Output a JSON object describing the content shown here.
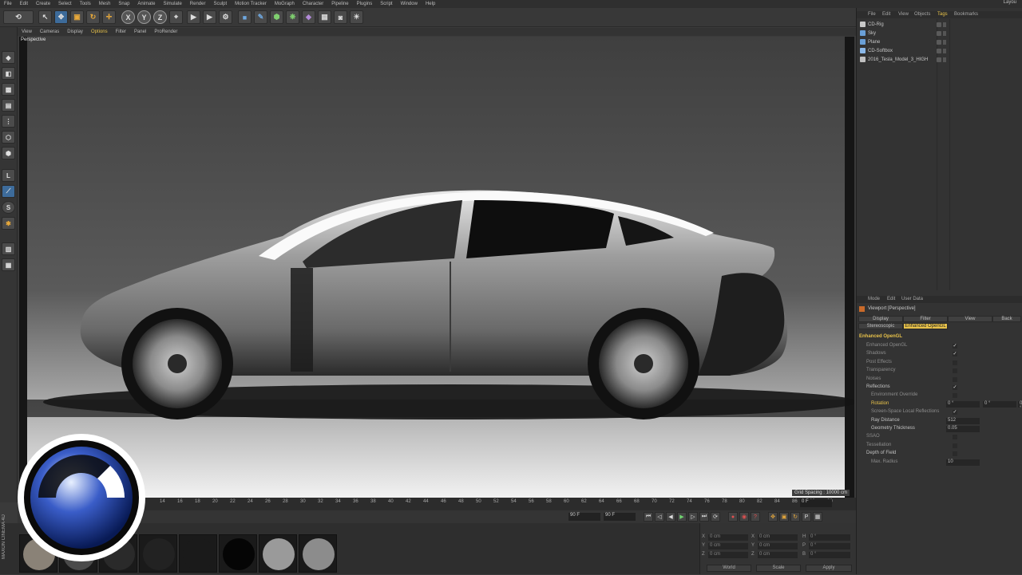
{
  "menubar": {
    "items": [
      "File",
      "Edit",
      "Create",
      "Select",
      "Tools",
      "Mesh",
      "Snap",
      "Animate",
      "Simulate",
      "Render",
      "Sculpt",
      "Motion Tracker",
      "MoGraph",
      "Character",
      "Pipeline",
      "Plugins",
      "Script",
      "Window",
      "Help"
    ],
    "layout_label": "Layou"
  },
  "toolbar": {
    "axis_x": "X",
    "axis_y": "Y",
    "axis_z": "Z"
  },
  "viewport_menu": {
    "items": [
      "View",
      "Cameras",
      "Display",
      "Options",
      "Filter",
      "Panel",
      "ProRender"
    ],
    "active": "Options"
  },
  "viewport": {
    "label": "Perspective",
    "grid_spacing": "Grid Spacing : 10000 cm"
  },
  "timeline": {
    "ticks": [
      "14",
      "16",
      "18",
      "20",
      "22",
      "24",
      "26",
      "28",
      "30",
      "32",
      "34",
      "36",
      "38",
      "40",
      "42",
      "44",
      "46",
      "48",
      "50",
      "52",
      "54",
      "56",
      "58",
      "60",
      "62",
      "64",
      "66",
      "68",
      "70",
      "72",
      "74",
      "76",
      "78",
      "80",
      "82",
      "84",
      "86",
      "88",
      "90"
    ],
    "current_frame": "0 F",
    "end_frame": "90 F",
    "start_field": "90 F"
  },
  "left_tools": {
    "s_label": "S"
  },
  "object_manager": {
    "menu": [
      "File",
      "Edit",
      "View",
      "Objects",
      "Tags",
      "Bookmarks"
    ],
    "active_menu": "Tags",
    "objects": [
      {
        "name": "CD-Rig",
        "icon_color": "#c8c8c8"
      },
      {
        "name": "Sky",
        "icon_color": "#6aa0d8"
      },
      {
        "name": "Plane",
        "icon_color": "#6aa0d8"
      },
      {
        "name": "CD-Softbox",
        "icon_color": "#8bb8e8"
      },
      {
        "name": "2016_Tesla_Model_3_HIGH",
        "icon_color": "#c0c0c0"
      }
    ]
  },
  "attribute_manager": {
    "menu": [
      "Mode",
      "Edit",
      "User Data"
    ],
    "title": "Viewport [Perspective]",
    "tabs_row1": [
      "Display",
      "Filter",
      "View",
      "Back"
    ],
    "tabs_row2": [
      "Stereoscopic",
      "Enhanced OpenGL"
    ],
    "active_tab": "Enhanced OpenGL",
    "section": "Enhanced OpenGL",
    "rows": [
      {
        "label": "Enhanced OpenGL",
        "check": "✓",
        "style": "dim"
      },
      {
        "label": "Shadows",
        "check": "✓",
        "style": "dim"
      },
      {
        "label": "Post Effects",
        "check": "",
        "style": "dim"
      },
      {
        "label": "Transparency",
        "check": "",
        "style": "dim"
      },
      {
        "label": "Noises",
        "check": "",
        "style": "dim"
      },
      {
        "label": "Reflections",
        "check": "✓",
        "style": "on"
      },
      {
        "label": "Environment Override",
        "check": "",
        "style": "dim"
      },
      {
        "label": "Rotation",
        "check": "",
        "style": "yel"
      },
      {
        "label": "Screen-Space Local Reflections",
        "check": "✓",
        "style": "dim"
      },
      {
        "label": "Ray Distance",
        "check": "",
        "style": "on"
      },
      {
        "label": "Geometry Thickness",
        "check": "",
        "style": "on"
      },
      {
        "label": "SSAO",
        "check": "",
        "style": "dim"
      },
      {
        "label": "Tessellation",
        "check": "",
        "style": "dim"
      },
      {
        "label": "Depth of Field",
        "check": "",
        "style": "on"
      },
      {
        "label": "Max. Radius",
        "check": "",
        "style": "dim"
      }
    ],
    "rotation_values": [
      "0 °",
      "0 °",
      "0 °"
    ],
    "ray_distance": "512",
    "geometry_thickness": "0.05",
    "max_radius": "10"
  },
  "coordinates": {
    "rows": [
      {
        "a": "X",
        "av": "0 cm",
        "b": "X",
        "bv": "0 cm",
        "c": "H",
        "cv": "0 °"
      },
      {
        "a": "Y",
        "av": "0 cm",
        "b": "Y",
        "bv": "0 cm",
        "c": "P",
        "cv": "0 °"
      },
      {
        "a": "Z",
        "av": "0 cm",
        "b": "Z",
        "bv": "0 cm",
        "c": "B",
        "cv": "0 °"
      }
    ],
    "world": "World",
    "scale": "Scale",
    "apply": "Apply"
  },
  "logo": {
    "text": "MAXON CINEMA 4D"
  },
  "colors": {
    "accent": "#e8c24a",
    "panel": "#333333"
  }
}
